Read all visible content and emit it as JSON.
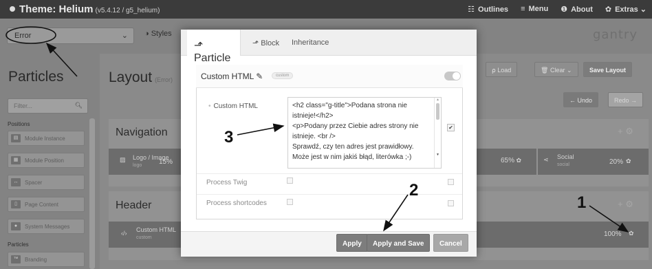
{
  "topbar": {
    "title": "Theme: Helium",
    "version": "(v5.4.12 / g5_helium)",
    "nav": [
      {
        "icon": "grid-icon",
        "glyph": "☷",
        "label": "Outlines"
      },
      {
        "icon": "menu-icon",
        "glyph": "≡",
        "label": "Menu"
      },
      {
        "icon": "info-icon",
        "glyph": "❶",
        "label": "About"
      },
      {
        "icon": "gear-icon",
        "glyph": "✿",
        "label": "Extras ⌄"
      }
    ]
  },
  "subbar": {
    "outline_select": "Error",
    "styles_tab": "Styles",
    "logo": "gantry"
  },
  "sidebar": {
    "title": "Particles",
    "filter_placeholder": "Filter...",
    "positions_label": "Positions",
    "position_items": [
      "Module Instance",
      "Module Position",
      "Spacer",
      "Page Content",
      "System Messages"
    ],
    "particles_label": "Particles",
    "particle_items": [
      "Branding"
    ]
  },
  "main": {
    "title": "Layout",
    "title_sub": "(Error)",
    "load": "Load",
    "clear": "Clear ⌄",
    "save_layout": "Save Layout",
    "undo": "Undo",
    "redo": "Redo",
    "sections": [
      {
        "title": "Navigation",
        "left_item": "Logo / Image",
        "left_sub": "logo",
        "left_pct": "15%",
        "mid_pct": "65%",
        "social": "Social",
        "social_sub": "social",
        "right_pct": "20%"
      },
      {
        "title": "Header",
        "left_item": "Custom HTML",
        "left_sub": "custom",
        "right_pct": "100%"
      }
    ]
  },
  "modal": {
    "tabs": [
      "Particle",
      "Block",
      "Inheritance"
    ],
    "panel_title": "Custom HTML",
    "panel_badge": "custom",
    "field_label": "Custom HTML",
    "editor_value": "<h2 class=\"g-title\">Podana strona nie istnieje!</h2>\n<p>Podany przez Ciebie adres strony nie istnieje. <br />\nSprawdź, czy ten adres jest prawidłowy. Może jest w nim jakiś błąd, literówka ;-)",
    "options": [
      "Process Twig",
      "Process shortcodes"
    ],
    "buttons": {
      "apply": "Apply",
      "apply_save": "Apply and Save",
      "cancel": "Cancel"
    }
  },
  "annotations": [
    "1",
    "2",
    "3"
  ]
}
